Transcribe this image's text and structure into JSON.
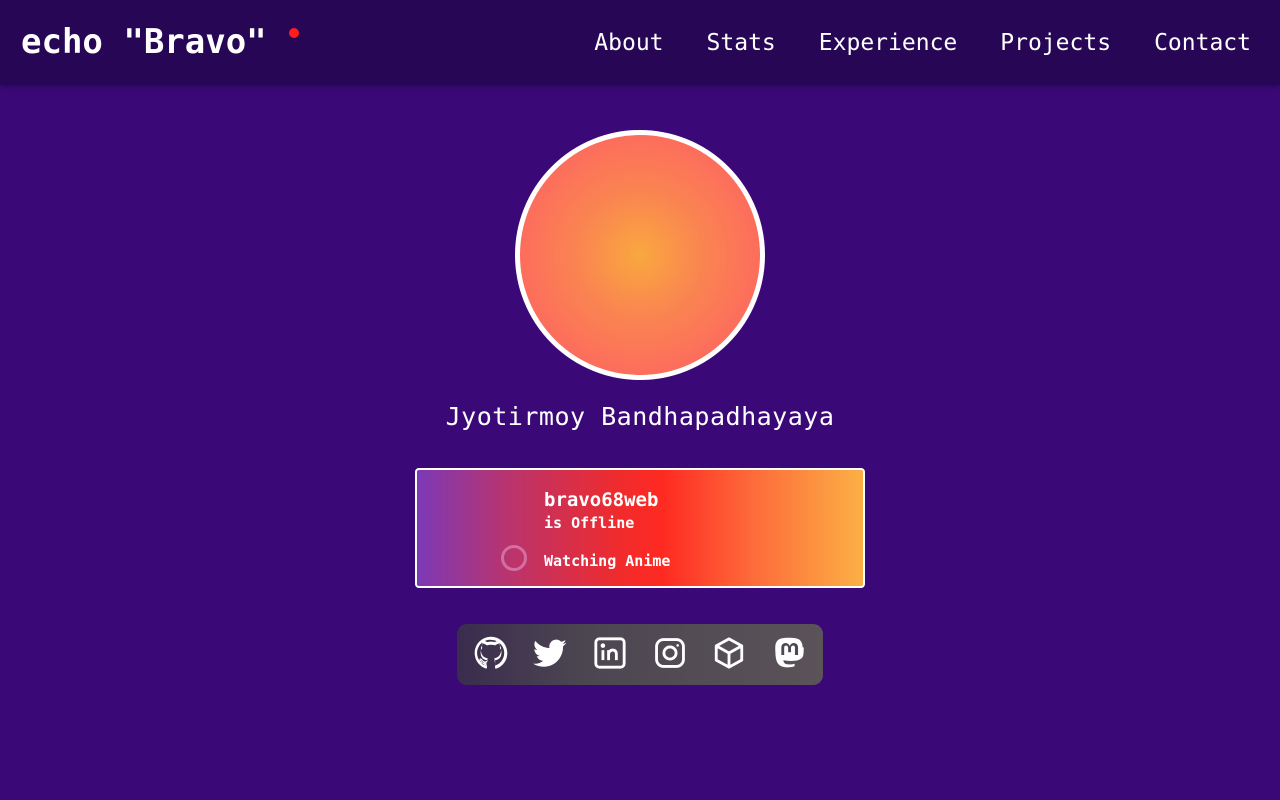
{
  "header": {
    "brand": "echo \"Bravo\"",
    "nav": [
      "About",
      "Stats",
      "Experience",
      "Projects",
      "Contact"
    ]
  },
  "profile": {
    "name": "Jyotirmoy Bandhapadhayaya"
  },
  "discord": {
    "username": "bravo68web",
    "status": "is Offline",
    "activity": "Watching Anime"
  },
  "social": {
    "icons": [
      "github-icon",
      "twitter-icon",
      "linkedin-icon",
      "instagram-icon",
      "cube-icon",
      "mastodon-icon"
    ]
  },
  "colors": {
    "page_background": "#3b0878",
    "navbar_background": "#270656",
    "brand_dot": "#ff1d1d",
    "avatar_border": "#ffffff"
  }
}
